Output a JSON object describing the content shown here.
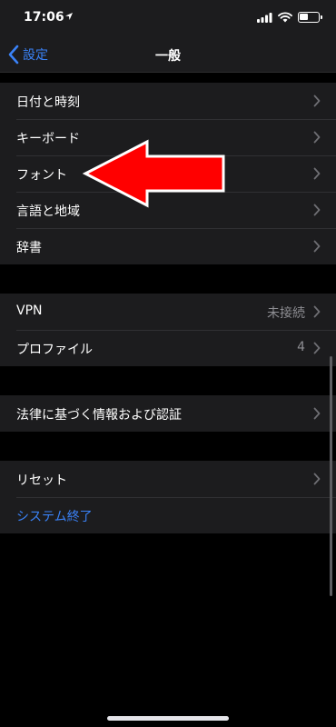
{
  "status": {
    "time": "17:06",
    "battery_level": 0.45,
    "icons": [
      "location-icon",
      "signal-icon",
      "wifi-icon",
      "battery-icon"
    ]
  },
  "nav": {
    "back_label": "設定",
    "title": "一般"
  },
  "groups": [
    [
      {
        "label": "日付と時刻"
      },
      {
        "label": "キーボード"
      },
      {
        "label": "フォント"
      },
      {
        "label": "言語と地域"
      },
      {
        "label": "辞書"
      }
    ],
    [
      {
        "label": "VPN",
        "value": "未接続"
      },
      {
        "label": "プロファイル",
        "value": "4"
      }
    ],
    [
      {
        "label": "法律に基づく情報および認証"
      }
    ],
    [
      {
        "label": "リセット"
      },
      {
        "label": "システム終了"
      }
    ]
  ],
  "colors": {
    "background": "#000000",
    "group_background": "#1c1c1e",
    "accent": "#3a82f7",
    "secondary_text": "#8e8e93",
    "annotation_arrow": "#ff0000"
  }
}
